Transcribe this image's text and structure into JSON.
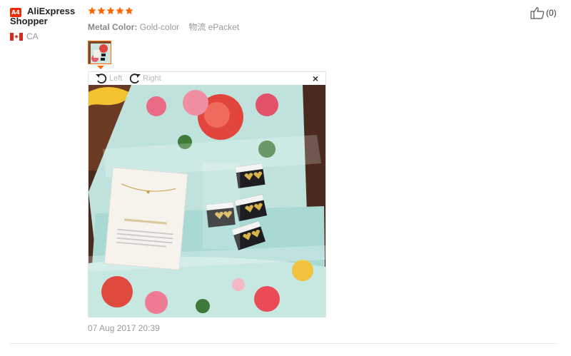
{
  "reviewer": {
    "badge": "A4",
    "name": "AliExpress Shopper",
    "country": "CA",
    "flag_icon": "flag-canada-icon"
  },
  "review": {
    "rating": 5,
    "rating_max": 5,
    "star_color": "#f60",
    "attributes": [
      {
        "key": "Metal Color:",
        "value": "Gold-color"
      }
    ],
    "shipping_label": "物流",
    "shipping_value": "ePacket",
    "date": "07 Aug 2017 20:39"
  },
  "image_viewer": {
    "rotate_left_label": "Left",
    "rotate_right_label": "Right",
    "close_symbol": "×"
  },
  "helpful": {
    "icon": "thumbs-up-icon",
    "count": "(0)"
  }
}
